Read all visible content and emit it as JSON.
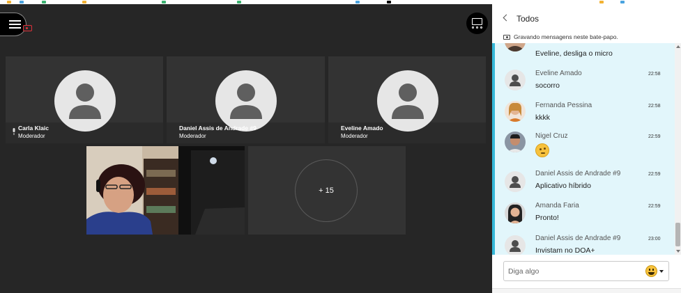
{
  "stage": {
    "participants": [
      {
        "name": "Carla Klaic",
        "role": "Moderador",
        "speaking": true
      },
      {
        "name": "Daniel Assis de Andrade #9",
        "role": "Moderador",
        "speaking": false
      },
      {
        "name": "Eveline Amado",
        "role": "Moderador",
        "speaking": false
      }
    ],
    "more_count": "+ 15"
  },
  "chat": {
    "title": "Todos",
    "recording_notice": "Gravando mensagens neste bate-papo.",
    "partial_message": "Eveline, desliga o micro",
    "messages": [
      {
        "sender": "Eveline Amado",
        "time": "22:58",
        "text": "socorro",
        "avatar": "default"
      },
      {
        "sender": "Fernanda Pessina",
        "time": "22:58",
        "text": "kkkk",
        "avatar": "photo"
      },
      {
        "sender": "Nigel Cruz",
        "time": "22:59",
        "text": "",
        "avatar": "photo",
        "emoji": "thinking-face"
      },
      {
        "sender": "Daniel Assis de Andrade #9",
        "time": "22:59",
        "text": "Aplicativo híbrido",
        "avatar": "default"
      },
      {
        "sender": "Amanda Faria",
        "time": "22:59",
        "text": "Pronto!",
        "avatar": "photo"
      },
      {
        "sender": "Daniel Assis de Andrade #9",
        "time": "23:00",
        "text": "Invistam no DOA+",
        "avatar": "default"
      }
    ],
    "input_placeholder": "Diga algo"
  },
  "colors": {
    "accent": "#36b8d8",
    "chat_bg": "#e2f6fb",
    "stage_bg": "#262626",
    "recording": "#e0313a"
  }
}
